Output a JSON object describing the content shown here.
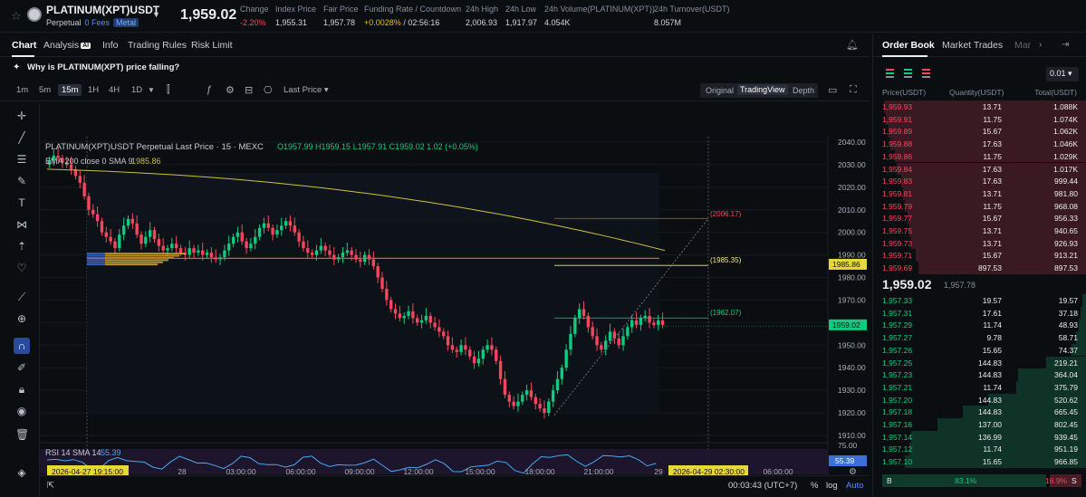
{
  "header": {
    "symbol": "PLATINUM(XPT)USDT",
    "perpetual": "Perpetual",
    "fees": "0 Fees",
    "metal": "Metal",
    "last_price": "1,959.02",
    "stats": [
      {
        "label": "Change",
        "value": "-2.20%",
        "tone": "red"
      },
      {
        "label": "Index Price",
        "value": "1,955.31",
        "tone": ""
      },
      {
        "label": "Fair Price",
        "value": "1,957.78",
        "tone": ""
      },
      {
        "label": "Funding Rate / Countdown",
        "value_a": "+0.0028%",
        "value_b": "/ 02:56:16"
      },
      {
        "label": "24h High",
        "value": "2,006.93",
        "tone": ""
      },
      {
        "label": "24h Low",
        "value": "1,917.97",
        "tone": ""
      },
      {
        "label": "24h Volume(PLATINUM(XPT))",
        "value": "4.054K",
        "tone": ""
      },
      {
        "label": "24h Turnover(USDT)",
        "value": "8.057M",
        "tone": ""
      }
    ]
  },
  "tabs": {
    "chart": "Chart",
    "analysis": "Analysis",
    "analysis_badge": "AI",
    "info": "Info",
    "trading_rules": "Trading Rules",
    "risk_limit": "Risk Limit"
  },
  "question": "Why is PLATINUM(XPT) price falling?",
  "toolbar": {
    "timeframes": [
      "1m",
      "5m",
      "15m",
      "1H",
      "4H",
      "1D"
    ],
    "active_timeframe": "15m",
    "price_type": "Last Price",
    "views": [
      "Original",
      "TradingView",
      "Depth"
    ],
    "active_view": "TradingView"
  },
  "chart": {
    "legend_title": "PLATINUM(XPT)USDT Perpetual Last Price · 15 · MEXC",
    "ohlc": "O1957.99  H1959.15  L1957.91  C1959.02  1.02 (+0.05%)",
    "ema_label": "EMA 200 close 0 SMA 9",
    "ema_value": "1985.86",
    "rsi_label": "RSI 14 SMA 14",
    "rsi_value": "55.39",
    "price_ticks": [
      "2040.00",
      "2030.00",
      "2020.00",
      "2010.00",
      "2000.00",
      "1990.00",
      "1980.00",
      "1970.00",
      "1960.00",
      "1950.00",
      "1940.00",
      "1930.00",
      "1920.00",
      "1910.00"
    ],
    "rsi_ticks": [
      "75.00",
      "55.39",
      "25.00"
    ],
    "price_tag": "1959.02",
    "ema_tag": "1985.86",
    "annotations": [
      "(2006.17)",
      "(1985.35)",
      "(1962.07)"
    ],
    "time_ticks": [
      "28",
      "03:00:00",
      "06:00:00",
      "09:00:00",
      "12:00:00",
      "15:00:00",
      "18:00:00",
      "21:00:00",
      "29",
      "06:00:00"
    ],
    "cursor_time_left": "2026-04-27   19:15:00",
    "cursor_time_right": "2026-04-29   02:30:00"
  },
  "bottombar": {
    "clock": "00:03:43 (UTC+7)",
    "percent": "%",
    "log": "log",
    "auto": "Auto"
  },
  "orderbook": {
    "tabs": [
      "Order Book",
      "Market Trades",
      "Mar"
    ],
    "precision": "0.01",
    "head_price": "Price(USDT)",
    "head_qty": "Quantity(USDT)",
    "head_total": "Total(USDT)",
    "asks": [
      {
        "p": "1,959.93",
        "q": "13.71",
        "t": "1.088K",
        "d": 0.95
      },
      {
        "p": "1,959.91",
        "q": "11.75",
        "t": "1.074K",
        "d": 0.94
      },
      {
        "p": "1,959.89",
        "q": "15.67",
        "t": "1.062K",
        "d": 0.93
      },
      {
        "p": "1,959.88",
        "q": "17.63",
        "t": "1.046K",
        "d": 0.92
      },
      {
        "p": "1,959.86",
        "q": "11.75",
        "t": "1.029K",
        "d": 0.9
      },
      {
        "p": "1,959.84",
        "q": "17.63",
        "t": "1.017K",
        "d": 0.89
      },
      {
        "p": "1,959.83",
        "q": "17.63",
        "t": "999.44",
        "d": 0.87
      },
      {
        "p": "1,959.81",
        "q": "13.71",
        "t": "981.80",
        "d": 0.86
      },
      {
        "p": "1,959.79",
        "q": "11.75",
        "t": "968.08",
        "d": 0.85
      },
      {
        "p": "1,959.77",
        "q": "15.67",
        "t": "956.33",
        "d": 0.84
      },
      {
        "p": "1,959.75",
        "q": "13.71",
        "t": "940.65",
        "d": 0.83
      },
      {
        "p": "1,959.73",
        "q": "13.71",
        "t": "926.93",
        "d": 0.82
      },
      {
        "p": "1,959.71",
        "q": "15.67",
        "t": "913.21",
        "d": 0.8
      },
      {
        "p": "1,959.69",
        "q": "897.53",
        "t": "897.53",
        "d": 0.79
      }
    ],
    "mid_price": "1,959.02",
    "mid_mark": "1,957.78",
    "bids": [
      {
        "p": "1,957.33",
        "q": "19.57",
        "t": "19.57",
        "d": 0.02
      },
      {
        "p": "1,957.31",
        "q": "17.61",
        "t": "37.18",
        "d": 0.03
      },
      {
        "p": "1,957.29",
        "q": "11.74",
        "t": "48.93",
        "d": 0.04
      },
      {
        "p": "1,957.27",
        "q": "9.78",
        "t": "58.71",
        "d": 0.05
      },
      {
        "p": "1,957.26",
        "q": "15.65",
        "t": "74.37",
        "d": 0.07
      },
      {
        "p": "1,957.25",
        "q": "144.83",
        "t": "219.21",
        "d": 0.19
      },
      {
        "p": "1,957.23",
        "q": "144.83",
        "t": "364.04",
        "d": 0.32
      },
      {
        "p": "1,957.21",
        "q": "11.74",
        "t": "375.79",
        "d": 0.33
      },
      {
        "p": "1,957.20",
        "q": "144.83",
        "t": "520.62",
        "d": 0.46
      },
      {
        "p": "1,957.18",
        "q": "144.83",
        "t": "665.45",
        "d": 0.58
      },
      {
        "p": "1,957.16",
        "q": "137.00",
        "t": "802.45",
        "d": 0.7
      },
      {
        "p": "1,957.14",
        "q": "136.99",
        "t": "939.45",
        "d": 0.82
      },
      {
        "p": "1,957.12",
        "q": "11.74",
        "t": "951.19",
        "d": 0.83
      },
      {
        "p": "1,957.10",
        "q": "15.65",
        "t": "966.85",
        "d": 0.85
      }
    ],
    "buy_label": "B",
    "buy_pct": "83.1%",
    "sell_pct": "16.9%",
    "sell_label": "S",
    "buy_ratio": 0.831
  },
  "colors": {
    "up": "#0ecb81",
    "down": "#f6465d",
    "ema": "#c9c23a",
    "rsi": "#4aa8f0",
    "accent": "#2a4a9e"
  }
}
